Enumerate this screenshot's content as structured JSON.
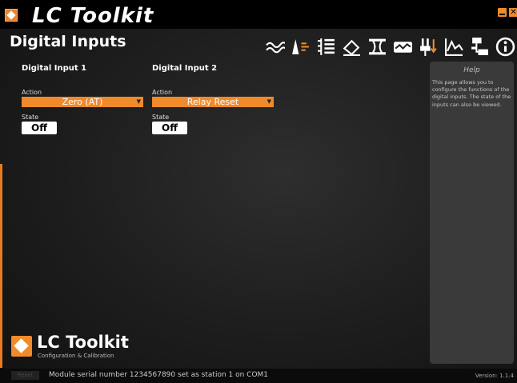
{
  "window": {
    "title": "LC Toolkit"
  },
  "page": {
    "title": "Digital Inputs"
  },
  "toolbar": {
    "icons": [
      "wave-icon",
      "calibrate-icon",
      "list-settings-icon",
      "eraser-icon",
      "filter-icon",
      "graph-box-icon",
      "io-pins-icon",
      "chart-icon",
      "network-icon",
      "info-icon",
      "home-icon"
    ]
  },
  "inputs": [
    {
      "title": "Digital Input 1",
      "action_label": "Action",
      "action_value": "Zero (AT)",
      "state_label": "State",
      "state_value": "Off"
    },
    {
      "title": "Digital Input 2",
      "action_label": "Action",
      "action_value": "Relay Reset",
      "state_label": "State",
      "state_value": "Off"
    }
  ],
  "help": {
    "title": "Help",
    "text": "This page allows you to configure the functions of the digital inputs. The state of the inputs can also be viewed."
  },
  "brand": {
    "name": "LC Toolkit",
    "tagline": "Configuration & Calibration"
  },
  "status": {
    "reset_label": "Reset",
    "message": "Module serial number 1234567890 set as station 1 on COM1",
    "version": "Version: 1.1.4"
  },
  "colors": {
    "accent": "#f08a2a",
    "background": "#1d1d1d",
    "panel": "#3a3a3a"
  }
}
